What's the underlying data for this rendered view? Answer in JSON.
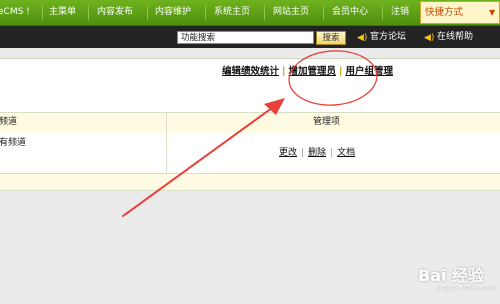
{
  "topnav": {
    "items": [
      "eCMS !",
      "主菜单",
      "内容发布",
      "内容维护",
      "系统主页",
      "网站主页",
      "会员中心",
      "注销"
    ],
    "quick_label": "快捷方式",
    "quick_arrow": "▼"
  },
  "toolbar": {
    "search_value": "功能搜索",
    "search_button": "搜索",
    "forum_label": "官方论坛",
    "help_label": "在线帮助"
  },
  "sublinks": {
    "edit_stats": "编辑绩效统计",
    "add_admin": "增加管理员",
    "user_group": "用户组管理",
    "separator": "|"
  },
  "table": {
    "col_channel_header": "频道",
    "col_manage_header": "管理项",
    "row_channel": "有频道",
    "actions": [
      "更改",
      "删除",
      "文档"
    ],
    "action_separator": "|"
  },
  "watermark": {
    "text": "Bai 经验",
    "url": "jingyan.baidu.com"
  },
  "colors": {
    "nav_green": "#5a9e14",
    "quick_bg": "#fff5c8",
    "annotation_red": "#e8403a"
  }
}
